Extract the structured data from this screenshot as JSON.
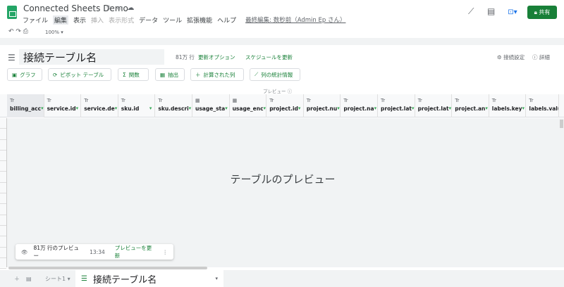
{
  "app": {
    "title": "Connected Sheets Demo",
    "menu": [
      "ファイル",
      "編集",
      "表示",
      "挿入",
      "表示形式",
      "データ",
      "ツール",
      "拡張機能",
      "ヘルプ"
    ],
    "last_edit": "最終編集: 数秒前（Admin Ep さん）",
    "share": "共有",
    "zoom": "100%"
  },
  "colors": {
    "accent": "#188038",
    "brand": "#23a566"
  },
  "connected": {
    "table_name": "接続テーブル名",
    "row_count": "81万 行",
    "refresh_options": "更新オプション",
    "schedule": "スケジュールを更新",
    "settings": "接続設定",
    "details": "詳細",
    "buttons": [
      "グラフ",
      "ピボット テーブル",
      "関数",
      "抽出",
      "計算された列",
      "列の統計情報"
    ],
    "preview_label": "プレビュー ⓘ",
    "columns": [
      {
        "type": "Tr",
        "name": "billing_acc"
      },
      {
        "type": "Tr",
        "name": "service.id"
      },
      {
        "type": "Tr",
        "name": "service.de"
      },
      {
        "type": "Tr",
        "name": "sku.id"
      },
      {
        "type": "Tr",
        "name": "sku.descri"
      },
      {
        "type": "date",
        "name": "usage_sta"
      },
      {
        "type": "date",
        "name": "usage_enc"
      },
      {
        "type": "Tr",
        "name": "project.id"
      },
      {
        "type": "Tr",
        "name": "project.nu"
      },
      {
        "type": "Tr",
        "name": "project.na"
      },
      {
        "type": "Tr",
        "name": "project.lat"
      },
      {
        "type": "Tr",
        "name": "project.lat"
      },
      {
        "type": "Tr",
        "name": "project.an"
      },
      {
        "type": "Tr",
        "name": "labels.key"
      },
      {
        "type": "Tr",
        "name": "labels.valu"
      }
    ],
    "preview_title": "テーブルのプレビュー",
    "toast": {
      "text": "81万 行のプレビュー",
      "time": "13:34",
      "refresh": "プレビューを更新"
    }
  },
  "sheets": {
    "tab1": "シート1",
    "active": "接続テーブル名"
  }
}
